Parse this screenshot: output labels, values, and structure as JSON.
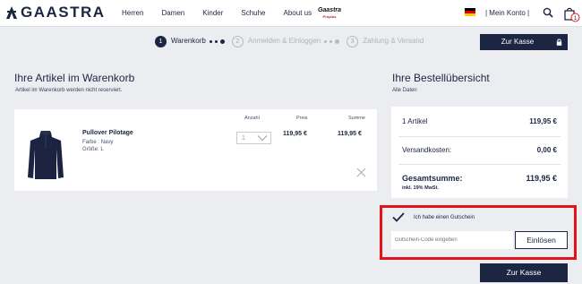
{
  "header": {
    "brand": "GAASTRA",
    "nav": [
      "Herren",
      "Damen",
      "Kinder",
      "Schuhe",
      "About us"
    ],
    "sub_brand_top": "Gaastra",
    "sub_brand_bottom": "Proplus",
    "account": "| Mein Konto |",
    "cart_count": "1"
  },
  "steps": [
    {
      "number": "1",
      "label": "Warenkorb",
      "state": "active"
    },
    {
      "number": "2",
      "label": "Anmelden & Einloggen",
      "state": "inactive"
    },
    {
      "number": "3",
      "label": "Zahlung & Versand",
      "state": "inactive"
    }
  ],
  "checkout_top_label": "Zur Kasse",
  "cart": {
    "title": "Ihre Artikel im Warenkorb",
    "subtitle": "Artikel im Warenkorb werden nicht reserviert.",
    "columns": {
      "qty": "Anzahl",
      "price": "Preis",
      "sum": "Summe"
    },
    "item": {
      "name": "Pullover Pilotage",
      "color": "Farbe : Navy",
      "size": "Größe: L",
      "qty": "1",
      "price": "119,95 €",
      "sum": "119,95 €"
    }
  },
  "summary": {
    "title": "Ihre Bestellübersicht",
    "subtitle": "Alle Daten",
    "items_label": "1 Artikel",
    "items_value": "119,95 €",
    "shipping_label": "Versandkosten:",
    "shipping_value": "0,00 €",
    "total_label": "Gesamtsumme:",
    "total_value": "119,95 €",
    "vat": "inkl. 19% MwSt."
  },
  "voucher": {
    "checkbox_label": "Ich habe einen Gutschein",
    "checked": true,
    "placeholder": "Gutschein-Code eingeben",
    "redeem_label": "Einlösen"
  },
  "checkout_bottom_label": "Zur Kasse",
  "colors": {
    "navy": "#1c2541",
    "background": "#ecedf0",
    "highlight": "#e3131b"
  }
}
